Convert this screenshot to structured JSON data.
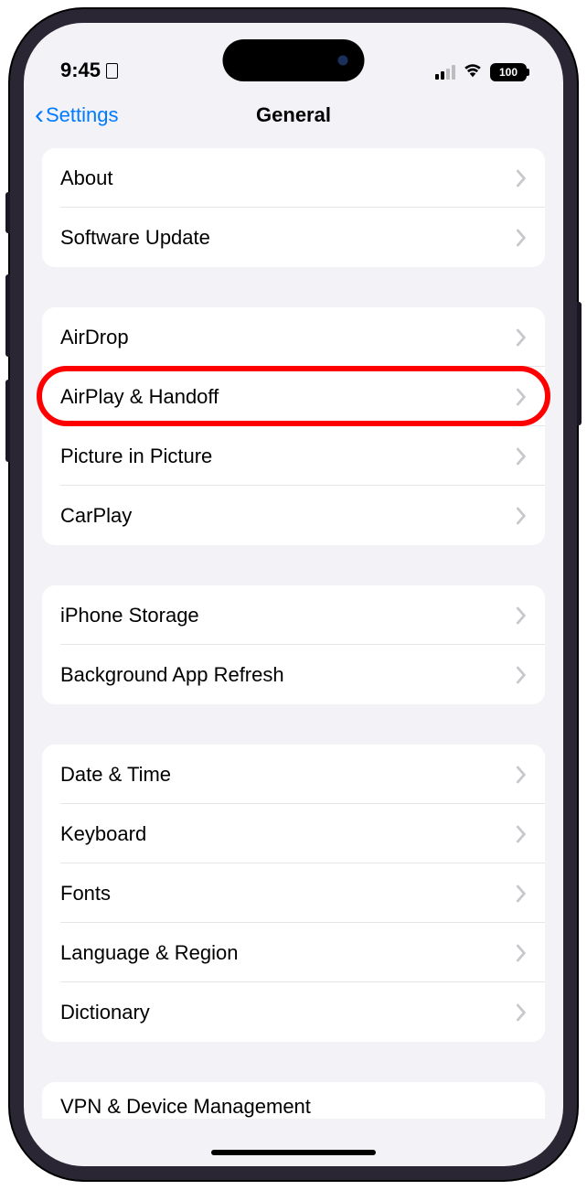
{
  "statusBar": {
    "time": "9:45",
    "battery": "100"
  },
  "navBar": {
    "backLabel": "Settings",
    "title": "General"
  },
  "groups": [
    {
      "items": [
        {
          "id": "about",
          "label": "About"
        },
        {
          "id": "software-update",
          "label": "Software Update"
        }
      ]
    },
    {
      "items": [
        {
          "id": "airdrop",
          "label": "AirDrop"
        },
        {
          "id": "airplay-handoff",
          "label": "AirPlay & Handoff",
          "highlighted": true
        },
        {
          "id": "picture-in-picture",
          "label": "Picture in Picture"
        },
        {
          "id": "carplay",
          "label": "CarPlay"
        }
      ]
    },
    {
      "items": [
        {
          "id": "iphone-storage",
          "label": "iPhone Storage"
        },
        {
          "id": "background-app-refresh",
          "label": "Background App Refresh"
        }
      ]
    },
    {
      "items": [
        {
          "id": "date-time",
          "label": "Date & Time"
        },
        {
          "id": "keyboard",
          "label": "Keyboard"
        },
        {
          "id": "fonts",
          "label": "Fonts"
        },
        {
          "id": "language-region",
          "label": "Language & Region"
        },
        {
          "id": "dictionary",
          "label": "Dictionary"
        }
      ]
    }
  ],
  "partialRow": {
    "label": "VPN & Device Management"
  }
}
